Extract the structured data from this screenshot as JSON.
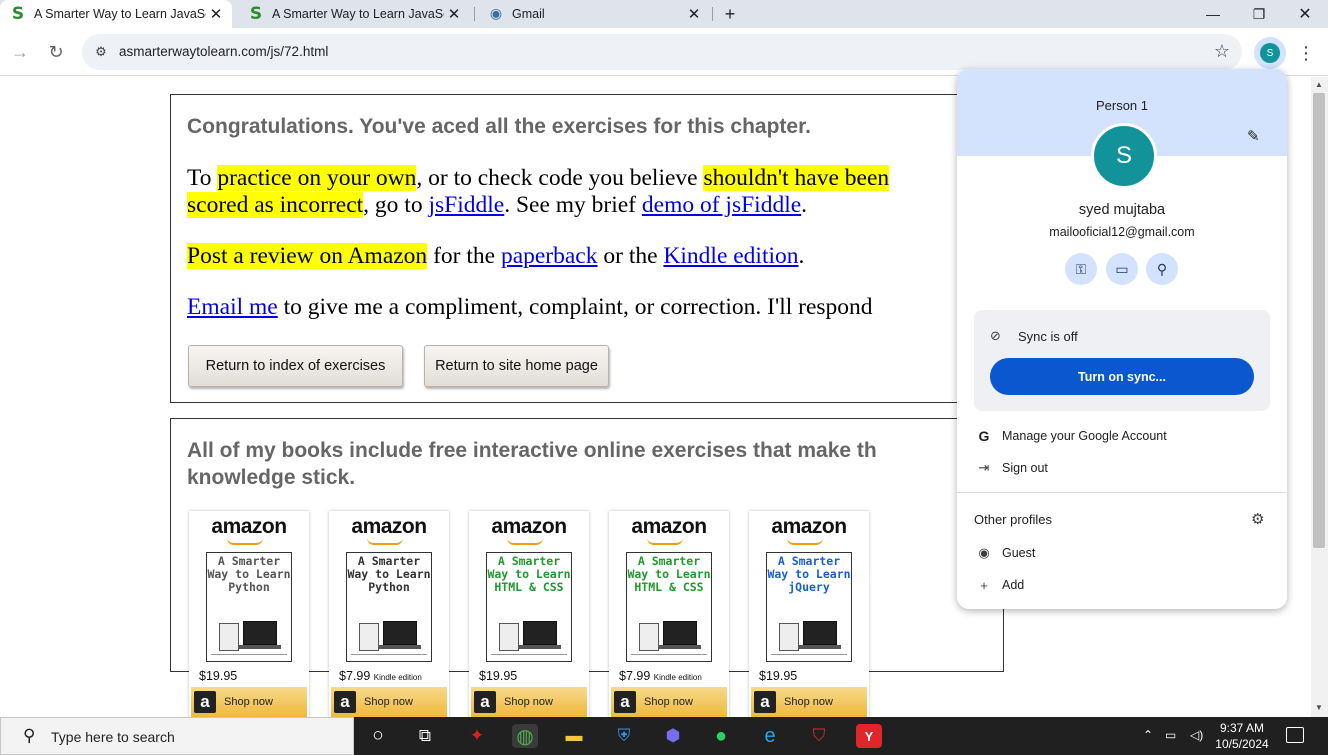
{
  "browser": {
    "tabs": [
      {
        "title": "A Smarter Way to Learn JavaScr",
        "favicon": "S",
        "active": true
      },
      {
        "title": "A Smarter Way to Learn JavaScr",
        "favicon": "S",
        "active": false
      },
      {
        "title": "Gmail",
        "favicon": "gmail-icon",
        "active": false
      }
    ],
    "url": "asmarterwaytolearn.com/js/72.html",
    "profile_initial": "S"
  },
  "page": {
    "congrats": "Congratulations. You've aced all the exercises for this chapter.",
    "p1": {
      "t1": "To ",
      "h1": "practice on your own",
      "t2": ", or to check code you believe ",
      "h2": "shouldn't have been",
      "h3": "scored as incorrect",
      "t3": ", go to ",
      "l1": "jsFiddle",
      "t4": ". See my brief ",
      "l2": "demo of jsFiddle",
      "t5": "."
    },
    "p2": {
      "h1": "Post a review on Amazon",
      "t1": " for the ",
      "l1": "paperback",
      "t2": " or the ",
      "l2": "Kindle edition",
      "t3": "."
    },
    "p3": {
      "l1": "Email me",
      "t1": " to give me a compliment, complaint, or correction. I'll respond"
    },
    "buttons": {
      "index": "Return to index of exercises",
      "home": "Return to site home page"
    },
    "books_heading_1": " All of my books include free interactive online exercises that make th",
    "books_heading_2": "knowledge stick.",
    "books": [
      {
        "logo": "amazon",
        "title": "A Smarter Way to Learn Python",
        "title_color": "#555555",
        "price": "$19.95",
        "edition": "",
        "shop": "Shop now"
      },
      {
        "logo": "amazon",
        "title": "A Smarter Way to Learn Python",
        "title_color": "#333333",
        "price": "$7.99",
        "edition": "Kindle edition",
        "shop": "Shop now"
      },
      {
        "logo": "amazon",
        "title": "A Smarter Way to Learn HTML & CSS",
        "title_color": "#1f9a2f",
        "price": "$19.95",
        "edition": "",
        "shop": "Shop now"
      },
      {
        "logo": "amazon",
        "title": "A Smarter Way to Learn HTML & CSS",
        "title_color": "#1f9a2f",
        "price": "$7.99",
        "edition": "Kindle edition",
        "shop": "Shop now"
      },
      {
        "logo": "amazon",
        "title": "A Smarter Way to Learn jQuery",
        "title_color": "#1a5fd0",
        "price": "$19.95",
        "edition": "",
        "shop": "Shop now"
      }
    ]
  },
  "profile_menu": {
    "header": "Person 1",
    "avatar_initial": "S",
    "name": "syed mujtaba",
    "email": "mailooficial12@gmail.com",
    "quick_actions": [
      "key-icon",
      "card-icon",
      "location-icon"
    ],
    "sync_status": "Sync is off",
    "sync_button": "Turn on sync...",
    "manage_account": "Manage your Google Account",
    "sign_out": "Sign out",
    "other_profiles": "Other profiles",
    "guest": "Guest",
    "add": "Add"
  },
  "taskbar": {
    "search_placeholder": "Type here to search",
    "time": "9:37 AM",
    "date": "10/5/2024"
  },
  "colors": {
    "highlight": "#ffff00",
    "link": "#0000ee",
    "accent_blue": "#0b57d0",
    "avatar_teal": "#12939a"
  }
}
